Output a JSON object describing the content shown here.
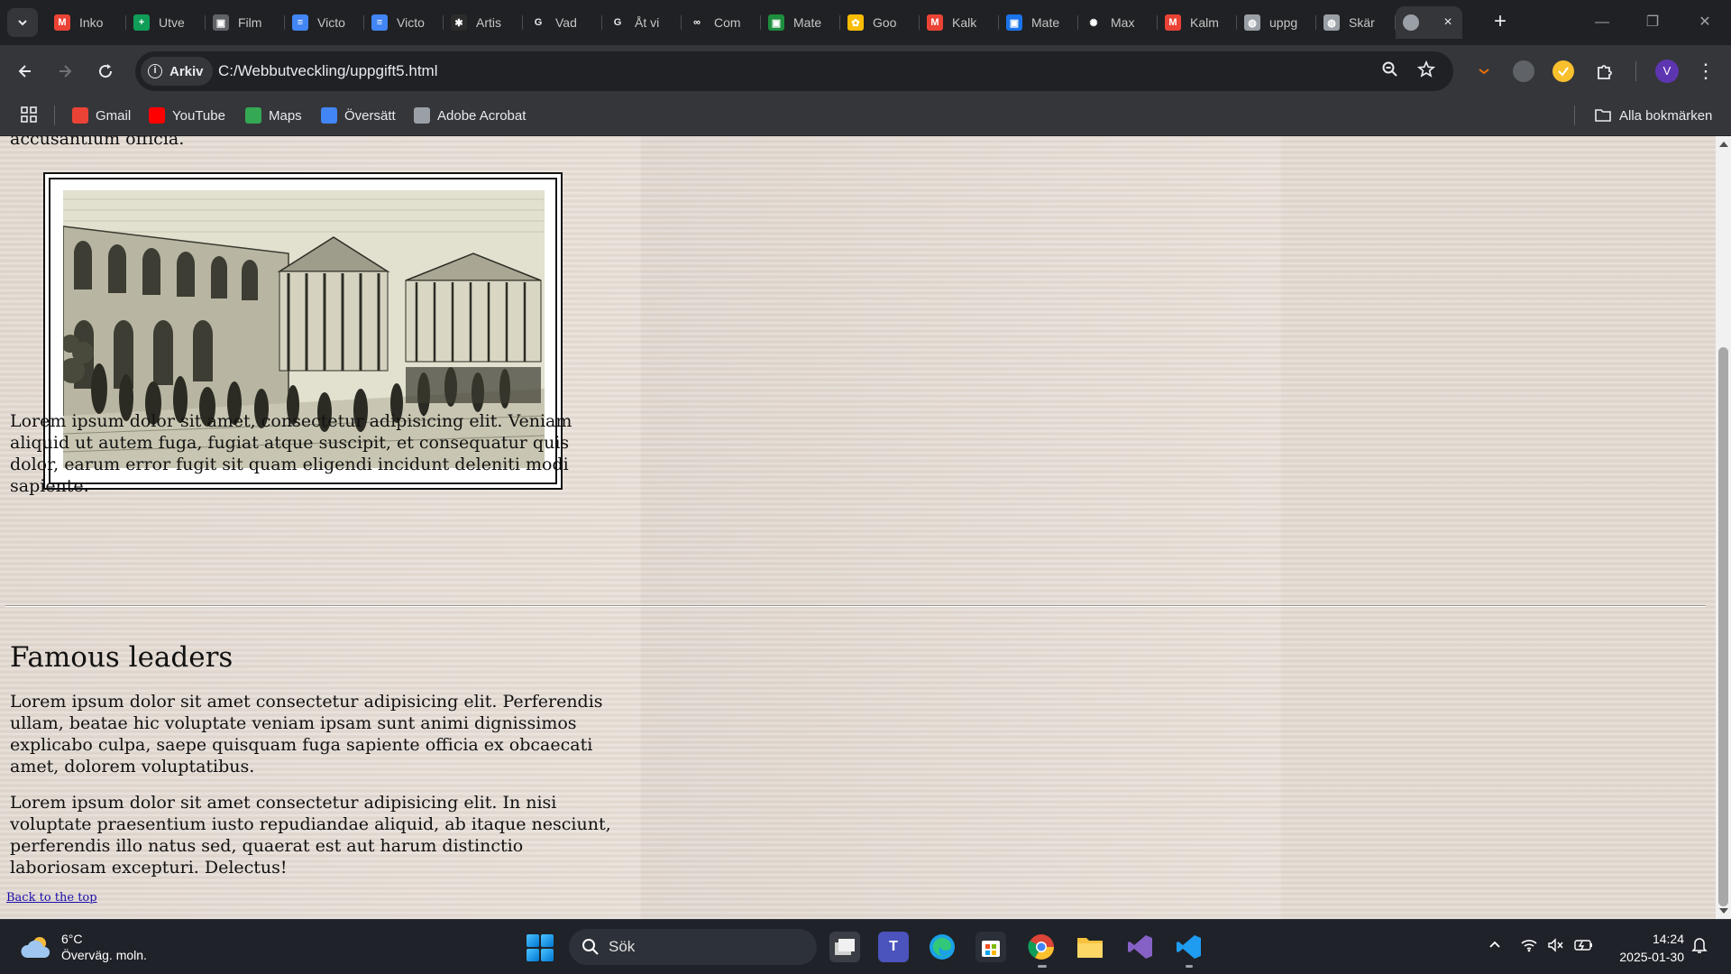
{
  "browser": {
    "tabs": [
      {
        "label": "Inko",
        "icon": "gmail-icon",
        "color": "#ea4335",
        "glyph": "M"
      },
      {
        "label": "Utve",
        "icon": "sheets-icon",
        "color": "#0f9d58",
        "glyph": "+"
      },
      {
        "label": "Film",
        "icon": "classroom-icon",
        "color": "#5f6368",
        "glyph": "▣"
      },
      {
        "label": "Victo",
        "icon": "docs-icon",
        "color": "#4285f4",
        "glyph": "≡"
      },
      {
        "label": "Victo",
        "icon": "docs-icon",
        "color": "#4285f4",
        "glyph": "≡"
      },
      {
        "label": "Artis",
        "icon": "artist-icon",
        "color": "#2b2b2b",
        "glyph": "✱"
      },
      {
        "label": "Vad",
        "icon": "google-icon",
        "color": "#ffffff",
        "glyph": "G"
      },
      {
        "label": "Åt vi",
        "icon": "google-icon",
        "color": "#ffffff",
        "glyph": "G"
      },
      {
        "label": "Com",
        "icon": "link-icon",
        "color": "#202124",
        "glyph": "∞"
      },
      {
        "label": "Mate",
        "icon": "classroom-icon",
        "color": "#1e8e3e",
        "glyph": "▣"
      },
      {
        "label": "Goo",
        "icon": "google-photos-icon",
        "color": "#fbbc04",
        "glyph": "✿"
      },
      {
        "label": "Kalk",
        "icon": "gmail-icon",
        "color": "#ea4335",
        "glyph": "M"
      },
      {
        "label": "Mate",
        "icon": "classroom-icon",
        "color": "#1a73e8",
        "glyph": "▣"
      },
      {
        "label": "Max",
        "icon": "openai-icon",
        "color": "#202124",
        "glyph": "✺"
      },
      {
        "label": "Kalm",
        "icon": "gmail-icon",
        "color": "#ea4335",
        "glyph": "M"
      },
      {
        "label": "uppg",
        "icon": "globe-icon",
        "color": "#9aa0a6",
        "glyph": "◍"
      },
      {
        "label": "Skär",
        "icon": "globe-icon",
        "color": "#9aa0a6",
        "glyph": "◍"
      }
    ],
    "active_tab_close": "×",
    "new_tab": "+",
    "window_controls": {
      "minimize": "—",
      "restore": "❐",
      "close": "✕"
    },
    "site_chip": "Arkiv",
    "url": "C:/Webbutveckling/uppgift5.html",
    "profile_initial": "V",
    "bookmarks": [
      {
        "label": "Gmail",
        "icon": "gmail-icon",
        "color": "#ea4335"
      },
      {
        "label": "YouTube",
        "icon": "youtube-icon",
        "color": "#ff0000"
      },
      {
        "label": "Maps",
        "icon": "maps-icon",
        "color": "#34a853"
      },
      {
        "label": "Översätt",
        "icon": "translate-icon",
        "color": "#4285f4"
      },
      {
        "label": "Adobe Acrobat",
        "icon": "acrobat-icon",
        "color": "#9aa0a6"
      }
    ],
    "all_bookmarks": "Alla bokmärken"
  },
  "page": {
    "cut_top_text": "accusantium officia.",
    "paragraph_after_image": "Lorem ipsum dolor sit amet, consectetur adipisicing elit. Veniam aliquid ut autem fuga, fugiat atque suscipit, et consequatur quis dolor, earum error fugit sit quam eligendi incidunt deleniti modi sapiente.",
    "heading": "Famous leaders",
    "paragraph_1": "Lorem ipsum dolor sit amet consectetur adipisicing elit. Perferendis ullam, beatae hic voluptate veniam ipsam sunt animi dignissimos explicabo culpa, saepe quisquam fuga sapiente officia ex obcaecati amet, dolorem voluptatibus.",
    "paragraph_2": "Lorem ipsum dolor sit amet consectetur adipisicing elit. In nisi voluptate praesentium iusto repudiandae aliquid, ab itaque nesciunt, perferendis illo natus sed, quaerat est aut harum distinctio laboriosam excepturi. Delectus!",
    "back_link": "Back to the top"
  },
  "taskbar": {
    "weather_temp": "6°C",
    "weather_desc": "Överväg. moln.",
    "search_label": "Sök",
    "time": "14:24",
    "date": "2025-01-30"
  }
}
